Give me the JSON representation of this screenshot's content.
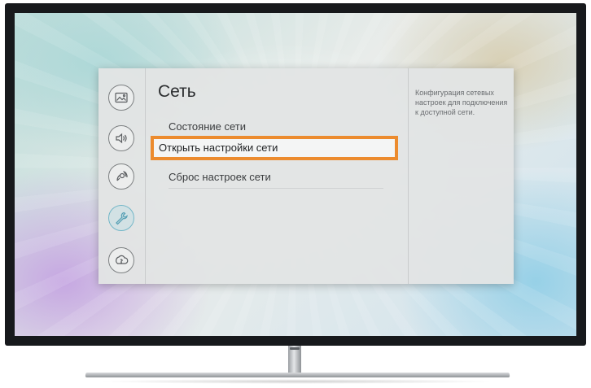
{
  "menu": {
    "title": "Сеть",
    "items": [
      {
        "label": "Состояние сети",
        "selected": false
      },
      {
        "label": "Открыть настройки сети",
        "selected": true
      },
      {
        "label": "Сброс настроек сети",
        "selected": false
      }
    ],
    "description": "Конфигурация сетевых настроек для подключения к доступной сети."
  },
  "sidebar": {
    "icons": [
      {
        "icon": "picture-icon",
        "active": false
      },
      {
        "icon": "sound-icon",
        "active": false
      },
      {
        "icon": "broadcast-icon",
        "active": false
      },
      {
        "icon": "wrench-icon",
        "active": true
      },
      {
        "icon": "support-icon",
        "active": false
      }
    ]
  },
  "colors": {
    "highlight_border": "#ec8b2e",
    "active_icon": "#74b7c8",
    "panel_background": "#e2e4e4"
  }
}
